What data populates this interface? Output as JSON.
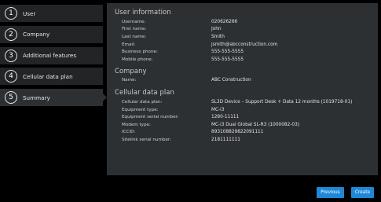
{
  "steps": [
    {
      "num": "1",
      "label": "User"
    },
    {
      "num": "2",
      "label": "Company"
    },
    {
      "num": "3",
      "label": "Additional features"
    },
    {
      "num": "4",
      "label": "Cellular data plan"
    },
    {
      "num": "5",
      "label": "Summary"
    }
  ],
  "summary": {
    "user_info": {
      "title": "User information",
      "rows": [
        {
          "label": "Username:",
          "value": "020626266"
        },
        {
          "label": "First name:",
          "value": "John"
        },
        {
          "label": "Last name:",
          "value": "Smith"
        },
        {
          "label": "Email:",
          "value": "jsmith@abcconstruction.com"
        },
        {
          "label": "Business phone:",
          "value": "555-555-5555"
        },
        {
          "label": "Mobile phone:",
          "value": "555-555-5555"
        }
      ]
    },
    "company": {
      "title": "Company",
      "rows": [
        {
          "label": "Name:",
          "value": "ABC Construction"
        }
      ]
    },
    "cellular": {
      "title": "Cellular data plan",
      "rows": [
        {
          "label": "Cellular data plan:",
          "value": "SL3D Device – Support Desk + Data 12 months (1019718-01)"
        },
        {
          "label": "Equipment type:",
          "value": "MC-i3"
        },
        {
          "label": "Equipment serial number:",
          "value": "1280-11111"
        },
        {
          "label": "Modem type:",
          "value": "MC-i3 Dual Global SL-R3 (1000082-03)"
        },
        {
          "label": "ICCID:",
          "value": "893108829822091111"
        },
        {
          "label": "Sitelink serial number:",
          "value": "2181111111"
        }
      ]
    }
  },
  "buttons": {
    "previous": "Previous",
    "create": "Create"
  },
  "colors": {
    "background": "#000000",
    "panel": "#2d3033",
    "step": "#222426",
    "accent": "#1e88d6"
  }
}
